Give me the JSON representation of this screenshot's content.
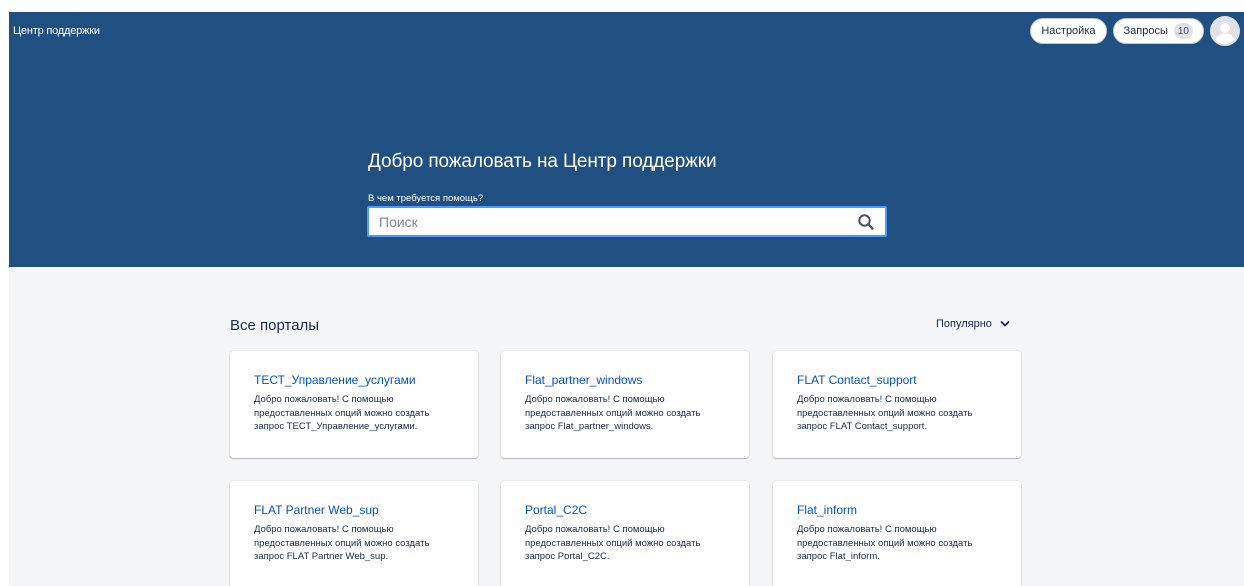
{
  "header": {
    "brand": "Центр поддержки",
    "settings_label": "Настройка",
    "requests_label": "Запросы",
    "requests_count": "10"
  },
  "hero": {
    "title": "Добро пожаловать на Центр поддержки",
    "search_label": "В чем требуется помощь?",
    "search_placeholder": "Поиск"
  },
  "portals": {
    "title": "Все порталы",
    "sort_label": "Популярно",
    "items": [
      {
        "title": "ТЕСТ_Управление_услугами",
        "description": "Добро пожаловать! С помощью предоставленных опций можно создать запрос ТЕСТ_Управление_услугами."
      },
      {
        "title": "Flat_partner_windows",
        "description": "Добро пожаловать! С помощью предоставленных опций можно создать запрос Flat_partner_windows."
      },
      {
        "title": "FLAT Contact_support",
        "description": "Добро пожаловать! С помощью предоставленных опций можно создать запрос FLAT Contact_support."
      },
      {
        "title": "FLAT Partner Web_sup",
        "description": "Добро пожаловать! С помощью предоставленных опций можно создать запрос FLAT Partner Web_sup."
      },
      {
        "title": "Portal_C2C",
        "description": "Добро пожаловать! С помощью предоставленных опций можно создать запрос Portal_C2C."
      },
      {
        "title": "Flat_inform",
        "description": "Добро пожаловать! С помощью предоставленных опций можно создать запрос Flat_inform."
      }
    ]
  },
  "colors": {
    "hero_background": "#205081",
    "page_background": "#f4f5f7",
    "link": "#0052cc",
    "text": "#172b4d",
    "search_focus": "#4c9aff"
  },
  "icons": {
    "search": "search-icon",
    "sort": "chevron-down-icon",
    "avatar": "user-avatar-icon"
  }
}
